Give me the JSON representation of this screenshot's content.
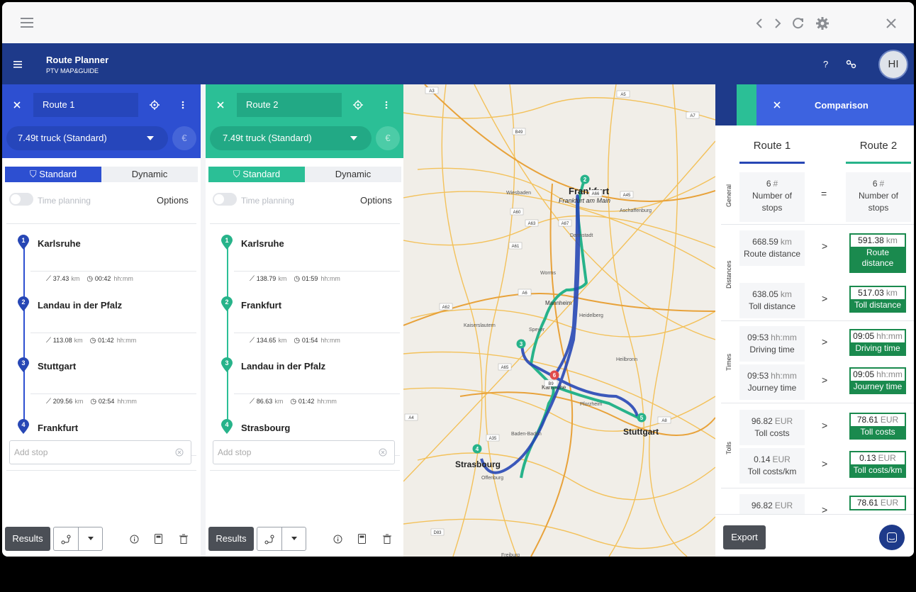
{
  "app": {
    "title": "Route Planner",
    "subtitle": "PTV MAP&GUIDE",
    "avatar_initials": "HI",
    "help_label": "?"
  },
  "colors": {
    "route1": "#2747b5",
    "route2": "#27b38a",
    "appbar": "#1e3a8a",
    "better": "#1a8a4e"
  },
  "routes": [
    {
      "name": "Route 1",
      "vehicle": "7.49t truck (Standard)",
      "currency_symbol": "€",
      "mode_tabs": [
        "Standard",
        "Dynamic"
      ],
      "time_planning_label": "Time planning",
      "options_label": "Options",
      "stops": [
        {
          "num": "1",
          "name": "Karlsruhe"
        },
        {
          "num": "2",
          "name": "Landau in der Pfalz"
        },
        {
          "num": "3",
          "name": "Stuttgart"
        },
        {
          "num": "4",
          "name": "Frankfurt"
        }
      ],
      "segments": [
        {
          "dist": "37.43",
          "dist_unit": "km",
          "time": "00:42",
          "time_unit": "hh:mm"
        },
        {
          "dist": "113.08",
          "dist_unit": "km",
          "time": "01:42",
          "time_unit": "hh:mm"
        },
        {
          "dist": "209.56",
          "dist_unit": "km",
          "time": "02:54",
          "time_unit": "hh:mm"
        }
      ],
      "add_stop_placeholder": "Add stop",
      "results_label": "Results"
    },
    {
      "name": "Route 2",
      "vehicle": "7.49t truck (Standard)",
      "currency_symbol": "€",
      "mode_tabs": [
        "Standard",
        "Dynamic"
      ],
      "time_planning_label": "Time planning",
      "options_label": "Options",
      "stops": [
        {
          "num": "1",
          "name": "Karlsruhe"
        },
        {
          "num": "2",
          "name": "Frankfurt"
        },
        {
          "num": "3",
          "name": "Landau in der Pfalz"
        },
        {
          "num": "4",
          "name": "Strasbourg"
        }
      ],
      "segments": [
        {
          "dist": "138.79",
          "dist_unit": "km",
          "time": "01:59",
          "time_unit": "hh:mm"
        },
        {
          "dist": "134.65",
          "dist_unit": "km",
          "time": "01:54",
          "time_unit": "hh:mm"
        },
        {
          "dist": "86.63",
          "dist_unit": "km",
          "time": "01:42",
          "time_unit": "hh:mm"
        }
      ],
      "add_stop_placeholder": "Add stop",
      "results_label": "Results"
    }
  ],
  "map": {
    "cities": [
      "Frankfurt",
      "Frankfurt am Main",
      "Karlsruhe",
      "Stuttgart",
      "Strasbourg",
      "Mannheim",
      "Darmstadt",
      "Heidelberg",
      "Wiesbaden",
      "Offenburg",
      "Freiburg",
      "Pforzheim",
      "Kaiserslautern",
      "Baden-Baden",
      "Speyer",
      "Worms",
      "Heilbronn",
      "Aschaffenburg"
    ],
    "roads": [
      "A3",
      "A5",
      "A6",
      "A7",
      "A45",
      "A60",
      "A61",
      "A62",
      "A63",
      "A65",
      "A66",
      "A67",
      "A4",
      "A35",
      "A8",
      "B49",
      "B9",
      "D83"
    ],
    "markers": [
      "2",
      "3",
      "4",
      "5",
      "6"
    ]
  },
  "comparison": {
    "title": "Comparison",
    "headers": [
      "Route 1",
      "Route 2"
    ],
    "export_label": "Export",
    "groups": [
      {
        "label": "General",
        "rows": [
          {
            "r1_val": "6",
            "r1_unit": "#",
            "r1_label": "Number of stops",
            "op": "=",
            "r2_val": "6",
            "r2_unit": "#",
            "r2_label": "Number of stops"
          }
        ]
      },
      {
        "label": "Distances",
        "rows": [
          {
            "r1_val": "668.59",
            "r1_unit": "km",
            "r1_label": "Route distance",
            "op": ">",
            "r2_val": "591.38",
            "r2_unit": "km",
            "r2_label": "Route distance"
          },
          {
            "r1_val": "638.05",
            "r1_unit": "km",
            "r1_label": "Toll distance",
            "op": ">",
            "r2_val": "517.03",
            "r2_unit": "km",
            "r2_label": "Toll distance"
          }
        ]
      },
      {
        "label": "Times",
        "rows": [
          {
            "r1_val": "09:53",
            "r1_unit": "hh:mm",
            "r1_label": "Driving time",
            "op": ">",
            "r2_val": "09:05",
            "r2_unit": "hh:mm",
            "r2_label": "Driving time"
          },
          {
            "r1_val": "09:53",
            "r1_unit": "hh:mm",
            "r1_label": "Journey time",
            "op": ">",
            "r2_val": "09:05",
            "r2_unit": "hh:mm",
            "r2_label": "Journey time"
          }
        ]
      },
      {
        "label": "Tolls",
        "rows": [
          {
            "r1_val": "96.82",
            "r1_unit": "EUR",
            "r1_label": "Toll costs",
            "op": ">",
            "r2_val": "78.61",
            "r2_unit": "EUR",
            "r2_label": "Toll costs"
          },
          {
            "r1_val": "0.14",
            "r1_unit": "EUR",
            "r1_label": "Toll costs/km",
            "op": ">",
            "r2_val": "0.13",
            "r2_unit": "EUR",
            "r2_label": "Toll costs/km"
          }
        ]
      },
      {
        "label": "",
        "rows": [
          {
            "r1_val": "96.82",
            "r1_unit": "EUR",
            "r1_label": "",
            "op": ">",
            "r2_val": "78.61",
            "r2_unit": "EUR",
            "r2_label": ""
          }
        ]
      }
    ]
  }
}
